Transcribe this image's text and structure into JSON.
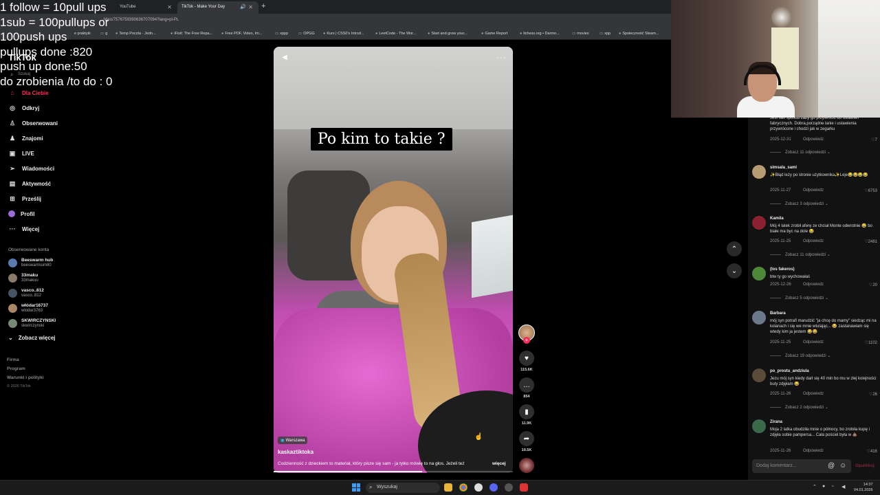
{
  "browser": {
    "tabs": [
      {
        "label": "YouTube"
      },
      {
        "label": "TikTok - Make Your Day"
      }
    ],
    "url": "/ideo/7576759390636707094?lang=pl-PL",
    "bookmarks": [
      "e praktyki",
      "g",
      "Temp Poczta - Jedn...",
      "iFixit: The Free Repa...",
      "Free PDF, Video, Im...",
      "xppp",
      "OPGG",
      "Kurs | CSS0's Introd...",
      "LeetCode - The Wor...",
      "Start and grow your...",
      "Game Report",
      "lichess.org • Darmo...",
      "movies",
      "xpp",
      "Społeczność Steam..."
    ]
  },
  "overlay": {
    "lines": [
      "1 follow = 10pull ups",
      "1sub = 100pullups or",
      "100push ups",
      "pullups done :820",
      "push up done:50",
      "do zrobienia /to do : 0"
    ]
  },
  "sidebar": {
    "logo": "TikTok",
    "search_placeholder": "Szukaj",
    "nav": [
      {
        "label": "Dla Ciebie",
        "icon": "home-icon"
      },
      {
        "label": "Odkryj",
        "icon": "compass-icon"
      },
      {
        "label": "Obserwowani",
        "icon": "user-icon"
      },
      {
        "label": "Znajomi",
        "icon": "friends-icon"
      },
      {
        "label": "LIVE",
        "icon": "live-icon"
      },
      {
        "label": "Wiadomości",
        "icon": "messages-icon"
      },
      {
        "label": "Aktywność",
        "icon": "activity-icon"
      },
      {
        "label": "Prześlij",
        "icon": "upload-icon"
      },
      {
        "label": "Profil",
        "icon": "profile-icon"
      },
      {
        "label": "Więcej",
        "icon": "more-icon"
      }
    ],
    "followed_title": "Obserwowane konta",
    "accounts": [
      {
        "name": "Beeswarm hub",
        "handle": "beeswarmsim80"
      },
      {
        "name": "33maku",
        "handle": "33makuu"
      },
      {
        "name": "vasco..812",
        "handle": "vasco..812"
      },
      {
        "name": "włódar16737",
        "handle": "wlodar3763"
      },
      {
        "name": "SKWIRCZYNSKI",
        "handle": "skwirczynski"
      }
    ],
    "see_more": "Zobacz więcej",
    "footer": [
      "Firma",
      "Program",
      "Warunki i polityki"
    ],
    "copyright": "© 2026 TikTok"
  },
  "video": {
    "caption": "Po kim to takie ?",
    "location": "Warszawa",
    "author": "kaskaztiktoka",
    "description": "Codzienność z dzieckiem to materiał, który pisze się sam - ja tylko mówię to na głos. Jeżeli też",
    "more_label": "więcej",
    "progress": 0.62
  },
  "actions": {
    "likes": "115.6K",
    "comments": "854",
    "saves": "11.9K",
    "shares": "19.5K"
  },
  "comments": {
    "first_text": "Jest taki sposób zaby go przywrócić do ustawień fabrycznych. Dobra,porządne lanie i ustawienia przywrócone i chodzi jak w zegarku",
    "first_date": "2025-12-31",
    "first_likes": "7",
    "first_view": "Zobacz 11 odpowiedzi",
    "reply_label": "Odpowiedz",
    "items": [
      {
        "user": "simsala_sami",
        "text": "✨Błąd leży po stronie użytkownika✨Leje😂😂😂😂",
        "date": "2025-11-27",
        "likes": "6753",
        "view": "Zobacz 3 odpowiedzi"
      },
      {
        "user": "Kamila",
        "text": "Mój 4 latek zrobił aferę ze chciał Monte odwrotnie 😂 bo białe ma byc na dole 😂",
        "date": "2025-11-25",
        "likes": "2481",
        "view": "Zobacz 11 odpowiedzi"
      },
      {
        "user": "(los fakeros)",
        "text": "btw ty go wychowałaś",
        "date": "2025-12-26",
        "likes": "20",
        "view": "Zobacz 5 odpowiedzi"
      },
      {
        "user": "Barbara",
        "text": "mój syn potrafi marudzić \"ja chcę do mamy\" siedząc mi na kolanach i się we mnie wtulając... 😂 zastanawiam się wtedy kim ja jestem 😂😂",
        "date": "2025-11-25",
        "likes": "1102",
        "view": "Zobacz 19 odpowiedzi"
      },
      {
        "user": "po_prostu_andziula",
        "text": "Jezu mój syn kiedy darł się 40 min bo mu w złej kolejności buty zdjęłam 😂",
        "date": "2025-11-26",
        "likes": "26",
        "view": "Zobacz 2 odpowiedzi"
      },
      {
        "user": "Zirana",
        "text": "Moja 2 latka obudziła mnie o północy, bo zrobiła kupę i zdjęła sobie pampersa... Cała pościel była w 💩",
        "date": "2025-11-26",
        "likes": "416",
        "view": ""
      }
    ],
    "input_placeholder": "Dodaj komentarz...",
    "post_label": "Opublikuj"
  },
  "taskbar": {
    "search_placeholder": "Wyszukaj",
    "time": "14:37",
    "date": "04.01.2026"
  }
}
